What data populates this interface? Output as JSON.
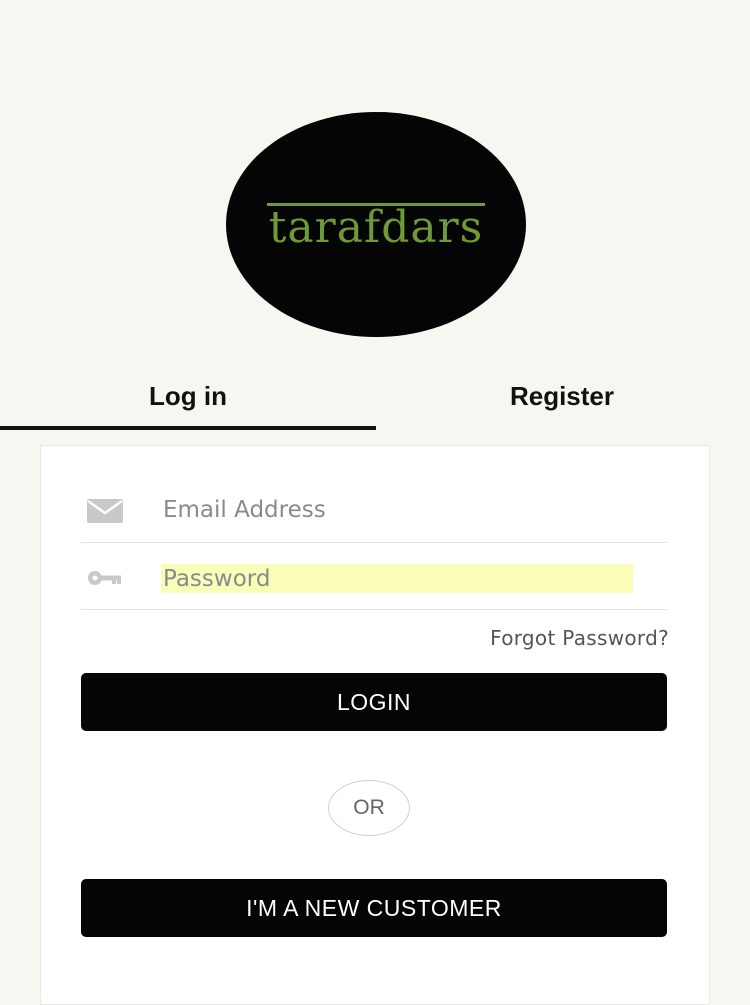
{
  "logo": {
    "text": "tarafdars",
    "text_color": "#6f9a35",
    "background": "#050505"
  },
  "tabs": [
    {
      "label": "Log in",
      "active": true
    },
    {
      "label": "Register",
      "active": false
    }
  ],
  "form": {
    "email": {
      "placeholder": "Email Address",
      "icon": "envelope-icon"
    },
    "password": {
      "placeholder": "Password",
      "icon": "key-icon",
      "autofill_highlight": "#fafdb7"
    },
    "forgot_label": "Forgot Password?",
    "login_label": "LOGIN",
    "or_label": "OR",
    "new_customer_label": "I'M A NEW CUSTOMER"
  },
  "colors": {
    "page_background": "#f8f6f1",
    "button_background": "#050505",
    "button_text": "#ffffff"
  }
}
